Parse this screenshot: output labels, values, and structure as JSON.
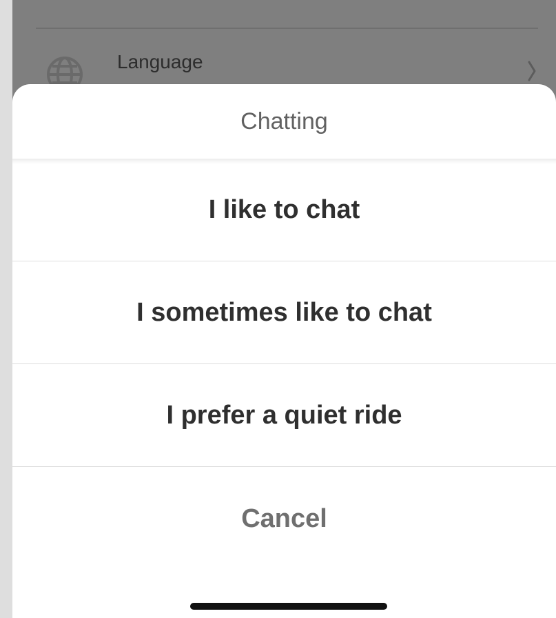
{
  "background": {
    "settings_label": "Language",
    "settings_icon": "globe-icon",
    "arrow_icon": "chevron-right-icon"
  },
  "sheet": {
    "title": "Chatting",
    "options": [
      {
        "label": "I like to chat"
      },
      {
        "label": "I sometimes like to chat"
      },
      {
        "label": "I prefer a quiet ride"
      }
    ],
    "cancel_label": "Cancel"
  },
  "colors": {
    "backdrop": "#7f7f7f",
    "sheet": "#ffffff",
    "text": "#2f2f2f",
    "muted": "#6f6f6f",
    "divider": "#dddddd",
    "home_indicator": "#111111"
  }
}
